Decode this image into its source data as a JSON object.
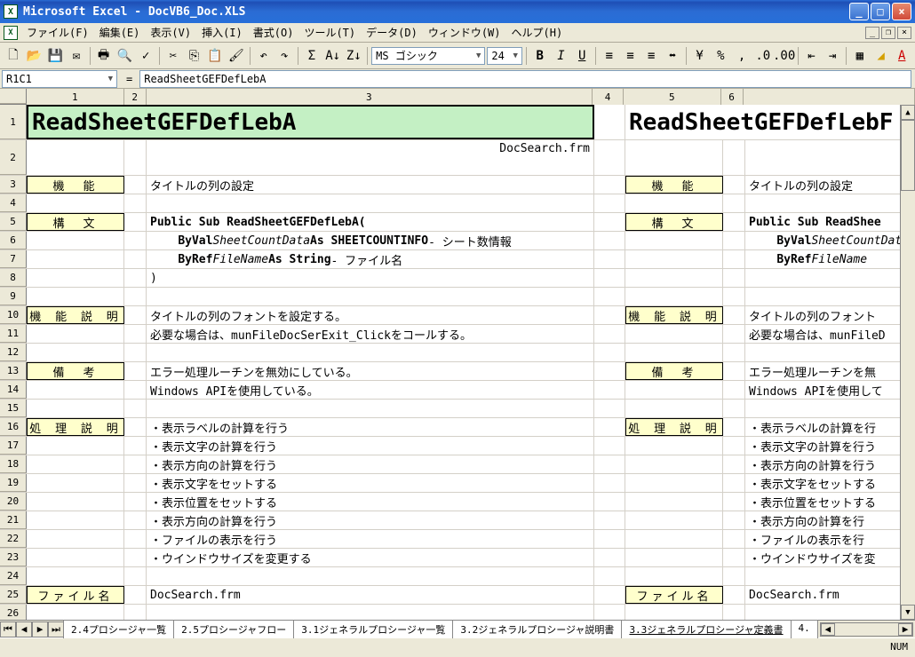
{
  "title": "Microsoft Excel - DocVB6_Doc.XLS",
  "menus": [
    "ファイル(F)",
    "編集(E)",
    "表示(V)",
    "挿入(I)",
    "書式(O)",
    "ツール(T)",
    "データ(D)",
    "ウィンドウ(W)",
    "ヘルプ(H)"
  ],
  "font": {
    "name": "MS ゴシック",
    "size": "24"
  },
  "cellref": "R1C1",
  "formula": "ReadSheetGEFDefLebA",
  "cols": {
    "1": "1",
    "2": "2",
    "3": "3",
    "4": "4",
    "5": "5",
    "6": "6"
  },
  "rows": {
    "title_left": "ReadSheetGEFDefLebA",
    "title_right": "ReadSheetGEFDefLebF",
    "docfile_top": "DocSearch.frm",
    "lab_func": "機　能",
    "val_func": "タイトルの列の設定",
    "lab_syn": "構　文",
    "syn1": "Public Sub ReadSheetGEFDefLebA(",
    "syn2a": "ByVal ",
    "syn2b": "SheetCountData",
    "syn2c": "  As SHEETCOUNTINFO",
    "syn2d": " - シート数情報",
    "syn3a": "ByRef ",
    "syn3b": "FileName",
    "syn3c": "       As String",
    "syn3d": "        - ファイル名",
    "syn4": ")",
    "syn1r": "Public Sub ReadShee",
    "syn2r": "ByVal SheetCountDat",
    "syn3r": "ByRef FileName",
    "lab_desc": "機 能 説 明",
    "desc1": "タイトルの列のフォントを設定する。",
    "desc2": "必要な場合は、munFileDocSerExit_Clickをコールする。",
    "desc1r": "タイトルの列のフォント",
    "desc2r": "必要な場合は、munFileD",
    "lab_note": "備　考",
    "note1": "エラー処理ルーチンを無効にしている。",
    "note2": "Windows APIを使用している。",
    "note1r": "エラー処理ルーチンを無",
    "note2r": "Windows APIを使用して",
    "lab_proc": "処 理 説 明",
    "p1": "・表示ラベルの計算を行う",
    "p1r": "・表示ラベルの計算を行",
    "p2": "・表示文字の計算を行う",
    "p2r": "・表示文字の計算を行う",
    "p3": "・表示方向の計算を行う",
    "p3r": "・表示方向の計算を行う",
    "p4": "・表示文字をセットする",
    "p4r": "・表示文字をセットする",
    "p5": "・表示位置をセットする",
    "p5r": "・表示位置をセットする",
    "p6": "  ・表示方向の計算を行う",
    "p6r": "  ・表示方向の計算を行",
    "p7": "  ・ファイルの表示を行う",
    "p7r": "  ・ファイルの表示を行",
    "p8": "・ウインドウサイズを変更する",
    "p8r": "・ウインドウサイズを変",
    "lab_file": "ファイル名",
    "val_file": "DocSearch.frm"
  },
  "tabs": [
    "2.4プロシージャ一覧",
    "2.5プロシージャフロー",
    "3.1ジェネラルプロシージャ一覧",
    "3.2ジェネラルプロシージャ説明書",
    "3.3ジェネラルプロシージャ定義書",
    "4."
  ],
  "active_tab": 4,
  "status": {
    "num": "NUM"
  }
}
